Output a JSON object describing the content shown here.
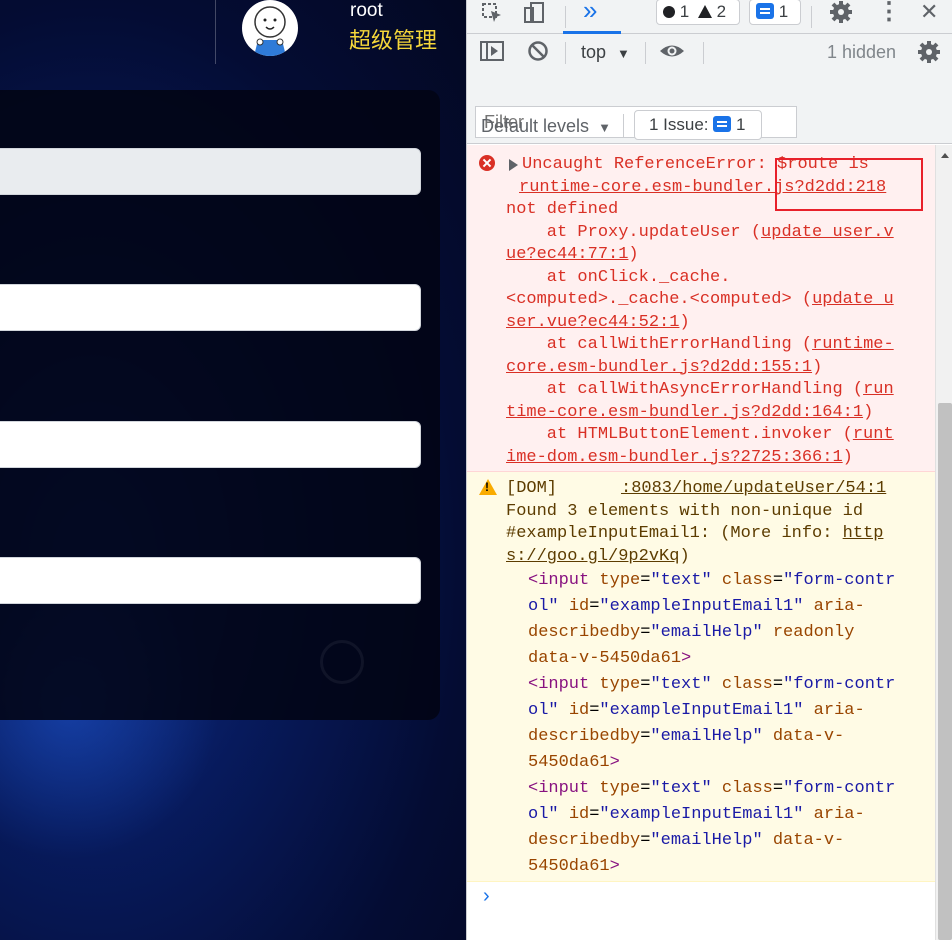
{
  "app": {
    "username": "root",
    "role": "超级管理"
  },
  "devtools": {
    "toolbar": {
      "more_tabs_icon": "»",
      "error_count": "1",
      "warning_count": "2",
      "issues_badge_count": "1",
      "settings_icon": "gear-icon",
      "menu_icon": "⋮",
      "close_icon": "✕"
    },
    "console_toolbar": {
      "context": "top",
      "hidden": "1 hidden",
      "filter_placeholder": "Filter",
      "levels": "Default levels",
      "issues_label": "1 Issue:",
      "issues_count": "1"
    },
    "error": {
      "l1": "Uncaught ReferenceError: $route is",
      "link1": "runtime-core.esm-bundler.js?d2dd:218",
      "l3": "not defined",
      "s1_pre": "    at Proxy.updateUser (",
      "s1_link_a": "update_user.v",
      "s1_link_b": "ue?ec44:77:1",
      "s2_pre": "    at onClick._cache.",
      "s2_b_pre": "<computed>._cache.<computed> (",
      "s2_link_a": "update_u",
      "s2_link_b": "ser.vue?ec44:52:1",
      "s3_pre": "    at callWithErrorHandling (",
      "s3_link_a": "runtime-",
      "s3_link_b": "core.esm-bundler.js?d2dd:155:1",
      "s4_pre": "    at callWithAsyncErrorHandling (",
      "s4_link_a": "run",
      "s4_link_b": "time-core.esm-bundler.js?d2dd:164:1",
      "s5_pre": "    at HTMLButtonElement.invoker (",
      "s5_link_a": "runt",
      "s5_link_b": "ime-dom.esm-bundler.js?2725:366:1",
      "close": ")"
    },
    "warning": {
      "prefix": "[DOM]",
      "source": ":8083/home/updateUser/54:1",
      "l2": "Found 3 elements with non-unique id",
      "l3_pre": "#exampleInputEmail1: (More info: ",
      "l3_link": "http",
      "l4_link": "s://goo.gl/9p2vKq",
      "l4_post": ")",
      "el1": [
        {
          "t": "<input ",
          "c": "tag"
        },
        {
          "t": "type",
          "c": "attr"
        },
        {
          "t": "=",
          "c": ""
        },
        {
          "t": "\"text\"",
          "c": "val"
        },
        {
          "t": " ",
          "c": ""
        },
        {
          "t": "class",
          "c": "attr"
        },
        {
          "t": "=",
          "c": ""
        },
        {
          "t": "\"form-contr",
          "c": "val"
        }
      ],
      "el1_b": [
        {
          "t": "ol\"",
          "c": "val"
        },
        {
          "t": " ",
          "c": ""
        },
        {
          "t": "id",
          "c": "attr"
        },
        {
          "t": "=",
          "c": ""
        },
        {
          "t": "\"exampleInputEmail1\"",
          "c": "val"
        },
        {
          "t": " ",
          "c": ""
        },
        {
          "t": "aria-",
          "c": "attr"
        }
      ],
      "el1_c": [
        {
          "t": "describedby",
          "c": "attr"
        },
        {
          "t": "=",
          "c": ""
        },
        {
          "t": "\"emailHelp\"",
          "c": "val"
        },
        {
          "t": " ",
          "c": ""
        },
        {
          "t": "readonly",
          "c": "attr"
        }
      ],
      "el1_d": [
        {
          "t": "data-v-5450da61",
          "c": "attr"
        },
        {
          "t": ">",
          "c": "tag"
        }
      ],
      "el2": [
        {
          "t": "<input ",
          "c": "tag"
        },
        {
          "t": "type",
          "c": "attr"
        },
        {
          "t": "=",
          "c": ""
        },
        {
          "t": "\"text\"",
          "c": "val"
        },
        {
          "t": " ",
          "c": ""
        },
        {
          "t": "class",
          "c": "attr"
        },
        {
          "t": "=",
          "c": ""
        },
        {
          "t": "\"form-contr",
          "c": "val"
        }
      ],
      "el2_b": [
        {
          "t": "ol\"",
          "c": "val"
        },
        {
          "t": " ",
          "c": ""
        },
        {
          "t": "id",
          "c": "attr"
        },
        {
          "t": "=",
          "c": ""
        },
        {
          "t": "\"exampleInputEmail1\"",
          "c": "val"
        },
        {
          "t": " ",
          "c": ""
        },
        {
          "t": "aria-",
          "c": "attr"
        }
      ],
      "el2_c": [
        {
          "t": "describedby",
          "c": "attr"
        },
        {
          "t": "=",
          "c": ""
        },
        {
          "t": "\"emailHelp\"",
          "c": "val"
        },
        {
          "t": " ",
          "c": ""
        },
        {
          "t": "data-v-",
          "c": "attr"
        }
      ],
      "el2_d": [
        {
          "t": "5450da61",
          "c": "attr"
        },
        {
          "t": ">",
          "c": "tag"
        }
      ],
      "el3": [
        {
          "t": "<input ",
          "c": "tag"
        },
        {
          "t": "type",
          "c": "attr"
        },
        {
          "t": "=",
          "c": ""
        },
        {
          "t": "\"text\"",
          "c": "val"
        },
        {
          "t": " ",
          "c": ""
        },
        {
          "t": "class",
          "c": "attr"
        },
        {
          "t": "=",
          "c": ""
        },
        {
          "t": "\"form-contr",
          "c": "val"
        }
      ],
      "el3_b": [
        {
          "t": "ol\"",
          "c": "val"
        },
        {
          "t": " ",
          "c": ""
        },
        {
          "t": "id",
          "c": "attr"
        },
        {
          "t": "=",
          "c": ""
        },
        {
          "t": "\"exampleInputEmail1\"",
          "c": "val"
        },
        {
          "t": " ",
          "c": ""
        },
        {
          "t": "aria-",
          "c": "attr"
        }
      ],
      "el3_c": [
        {
          "t": "describedby",
          "c": "attr"
        },
        {
          "t": "=",
          "c": ""
        },
        {
          "t": "\"emailHelp\"",
          "c": "val"
        },
        {
          "t": " ",
          "c": ""
        },
        {
          "t": "data-v-",
          "c": "attr"
        }
      ],
      "el3_d": [
        {
          "t": "5450da61",
          "c": "attr"
        },
        {
          "t": ">",
          "c": "tag"
        }
      ]
    },
    "prompt": "›"
  }
}
